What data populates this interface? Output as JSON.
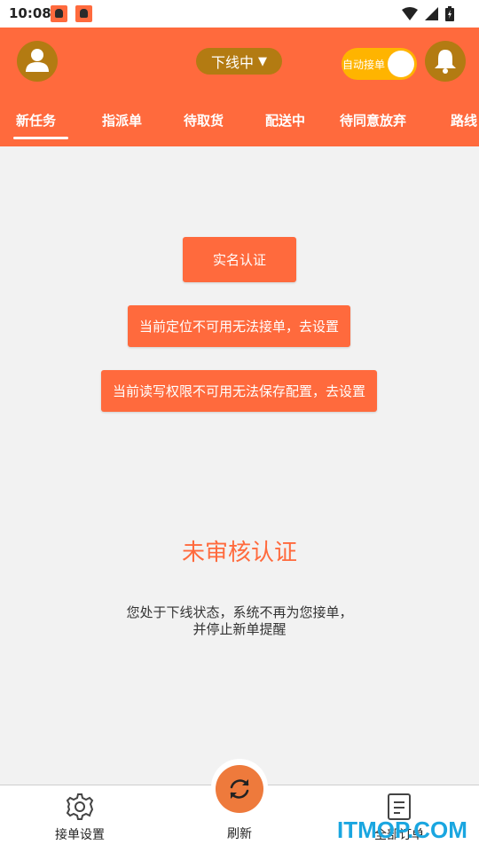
{
  "statusbar": {
    "time": "10:08"
  },
  "header": {
    "online_status": "下线中",
    "online_status_caret": "▼",
    "auto_accept_label": "自动接单"
  },
  "tabs": [
    {
      "label": "新任务",
      "active": true
    },
    {
      "label": "指派单",
      "active": false
    },
    {
      "label": "待取货",
      "active": false
    },
    {
      "label": "配送中",
      "active": false
    },
    {
      "label": "待同意放弃",
      "active": false
    },
    {
      "label": "路线",
      "active": false
    }
  ],
  "main": {
    "verify_button": "实名认证",
    "location_button": "当前定位不可用无法接单，去设置",
    "storage_button": "当前读写权限不可用无法保存配置，去设置",
    "unverified_title": "未审核认证",
    "offline_hint_line1": "您处于下线状态，系统不再为您接单，",
    "offline_hint_line2": "并停止新单提醒"
  },
  "bottom_nav": {
    "settings_label": "接单设置",
    "refresh_label": "刷新",
    "orders_label": "全部订单"
  },
  "watermark": "ITMOP.COM",
  "colors": {
    "accent": "#ff6a3d",
    "header_pill": "#b37b12",
    "toggle": "#ffb400",
    "refresh": "#ee7a3c"
  },
  "icons": [
    "user-icon",
    "bell-icon",
    "gear-icon",
    "refresh-icon",
    "document-icon",
    "wifi-icon",
    "signal-icon",
    "battery-icon"
  ]
}
